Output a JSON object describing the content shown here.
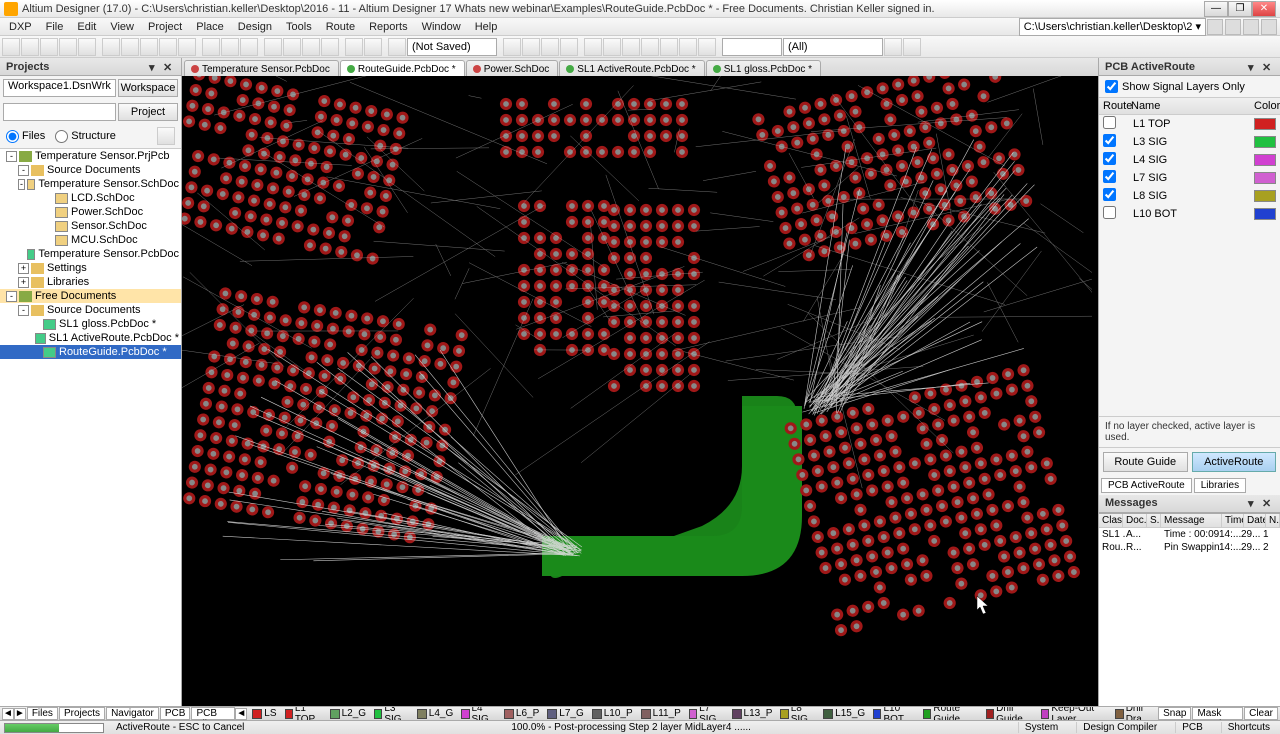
{
  "titlebar": {
    "title": "Altium Designer (17.0) - C:\\Users\\christian.keller\\Desktop\\2016 - 11 - Altium Designer 17 Whats new webinar\\Examples\\RouteGuide.PcbDoc * - Free Documents. Christian Keller signed in."
  },
  "menu": [
    "DXP",
    "File",
    "Edit",
    "View",
    "Project",
    "Place",
    "Design",
    "Tools",
    "Route",
    "Reports",
    "Window",
    "Help"
  ],
  "toolbar": {
    "combo1": "(Not Saved)",
    "combo2": "",
    "combo3": "(All)"
  },
  "contextPath": "C:\\Users\\christian.keller\\Desktop\\2 ▾",
  "projects": {
    "title": "Projects",
    "workspace": "Workspace1.DsnWrk",
    "workspaceBtn": "Workspace",
    "projectBtn": "Project",
    "files": "Files",
    "structure": "Structure",
    "tree": [
      {
        "d": 0,
        "exp": "-",
        "ico": "prj",
        "label": "Temperature Sensor.PrjPcb"
      },
      {
        "d": 1,
        "exp": "-",
        "ico": "fld",
        "label": "Source Documents"
      },
      {
        "d": 2,
        "exp": "-",
        "ico": "sch",
        "label": "Temperature Sensor.SchDoc"
      },
      {
        "d": 3,
        "exp": "",
        "ico": "sch",
        "label": "LCD.SchDoc"
      },
      {
        "d": 3,
        "exp": "",
        "ico": "sch",
        "label": "Power.SchDoc"
      },
      {
        "d": 3,
        "exp": "",
        "ico": "sch",
        "label": "Sensor.SchDoc"
      },
      {
        "d": 3,
        "exp": "",
        "ico": "sch",
        "label": "MCU.SchDoc"
      },
      {
        "d": 2,
        "exp": "",
        "ico": "pcb",
        "label": "Temperature Sensor.PcbDoc"
      },
      {
        "d": 1,
        "exp": "+",
        "ico": "fld",
        "label": "Settings"
      },
      {
        "d": 1,
        "exp": "+",
        "ico": "fld",
        "label": "Libraries"
      },
      {
        "d": 0,
        "exp": "-",
        "ico": "prj",
        "label": "Free Documents",
        "hl": true
      },
      {
        "d": 1,
        "exp": "-",
        "ico": "fld",
        "label": "Source Documents"
      },
      {
        "d": 2,
        "exp": "",
        "ico": "pcb",
        "label": "SL1 gloss.PcbDoc *"
      },
      {
        "d": 2,
        "exp": "",
        "ico": "pcb",
        "label": "SL1 ActiveRoute.PcbDoc *"
      },
      {
        "d": 2,
        "exp": "",
        "ico": "pcb",
        "label": "RouteGuide.PcbDoc *",
        "sel": true
      }
    ]
  },
  "docTabs": [
    {
      "label": "Temperature Sensor.PcbDoc",
      "color": "red"
    },
    {
      "label": "RouteGuide.PcbDoc *",
      "color": "grn",
      "active": true
    },
    {
      "label": "Power.SchDoc",
      "color": "red"
    },
    {
      "label": "SL1 ActiveRoute.PcbDoc *",
      "color": "grn"
    },
    {
      "label": "SL1 gloss.PcbDoc *",
      "color": "grn"
    }
  ],
  "activeRoute": {
    "title": "PCB ActiveRoute",
    "showSignal": "Show Signal Layers Only",
    "hdrRoute": "Route",
    "hdrName": "Name",
    "hdrColor": "Color",
    "layers": [
      {
        "checked": false,
        "name": "L1 TOP",
        "color": "#d02020"
      },
      {
        "checked": true,
        "name": "L3 SIG",
        "color": "#20c040"
      },
      {
        "checked": true,
        "name": "L4 SIG",
        "color": "#d040d0"
      },
      {
        "checked": true,
        "name": "L7 SIG",
        "color": "#d060d0"
      },
      {
        "checked": true,
        "name": "L8 SIG",
        "color": "#a8a020"
      },
      {
        "checked": false,
        "name": "L10 BOT",
        "color": "#2040d0"
      }
    ],
    "hint": "If no layer checked, active layer is used.",
    "routeGuideBtn": "Route Guide",
    "activeRouteBtn": "ActiveRoute",
    "tabs": [
      "PCB ActiveRoute",
      "Libraries"
    ]
  },
  "messages": {
    "title": "Messages",
    "cols": [
      "Class",
      "Doc...",
      "S...",
      "Message",
      "Time",
      "Date",
      "N..."
    ],
    "rows": [
      {
        "class": "SL1 ...",
        "doc": "A...",
        "s": "",
        "msg": "Time : 00:09",
        "time": "14:...",
        "date": "29...",
        "n": "1"
      },
      {
        "class": "Rou...",
        "doc": "R...",
        "s": "",
        "msg": "Pin Swapping ...",
        "time": "14:...",
        "date": "29...",
        "n": "2"
      }
    ]
  },
  "layerBar": {
    "leftBtns": [
      "Files",
      "Projects",
      "Navigator",
      "PCB",
      "PCB Filte"
    ],
    "layers": [
      {
        "name": "LS",
        "color": "#d02020"
      },
      {
        "name": "L1 TOP",
        "color": "#d02020"
      },
      {
        "name": "L2_G",
        "color": "#60a060"
      },
      {
        "name": "L3 SIG",
        "color": "#20c040"
      },
      {
        "name": "L4_G",
        "color": "#808060"
      },
      {
        "name": "L4 SIG",
        "color": "#d040d0"
      },
      {
        "name": "L6_P",
        "color": "#a06060"
      },
      {
        "name": "L7_G",
        "color": "#606080"
      },
      {
        "name": "L10_P",
        "color": "#606060"
      },
      {
        "name": "L11_P",
        "color": "#806060"
      },
      {
        "name": "L7 SIG",
        "color": "#d060d0"
      },
      {
        "name": "L13_P",
        "color": "#604060"
      },
      {
        "name": "L8 SIG",
        "color": "#a8a020"
      },
      {
        "name": "L15_G",
        "color": "#406040"
      },
      {
        "name": "L10 BOT",
        "color": "#2040d0"
      },
      {
        "name": "Route Guide",
        "color": "#20a020"
      },
      {
        "name": "Drill Guide",
        "color": "#a02020"
      },
      {
        "name": "Keep-Out Layer",
        "color": "#c040c0"
      },
      {
        "name": "Drill Dra",
        "color": "#806040"
      }
    ],
    "rightBtns": [
      "Snap",
      "Mask Level",
      "Clear"
    ]
  },
  "status": {
    "progressPct": 55,
    "mode": "ActiveRoute - ESC to Cancel",
    "info": "100.0% - Post-processing Step 2 layer MidLayer4 ......",
    "cells": [
      "System",
      "Design Compiler",
      "PCB",
      "Shortcuts"
    ]
  }
}
